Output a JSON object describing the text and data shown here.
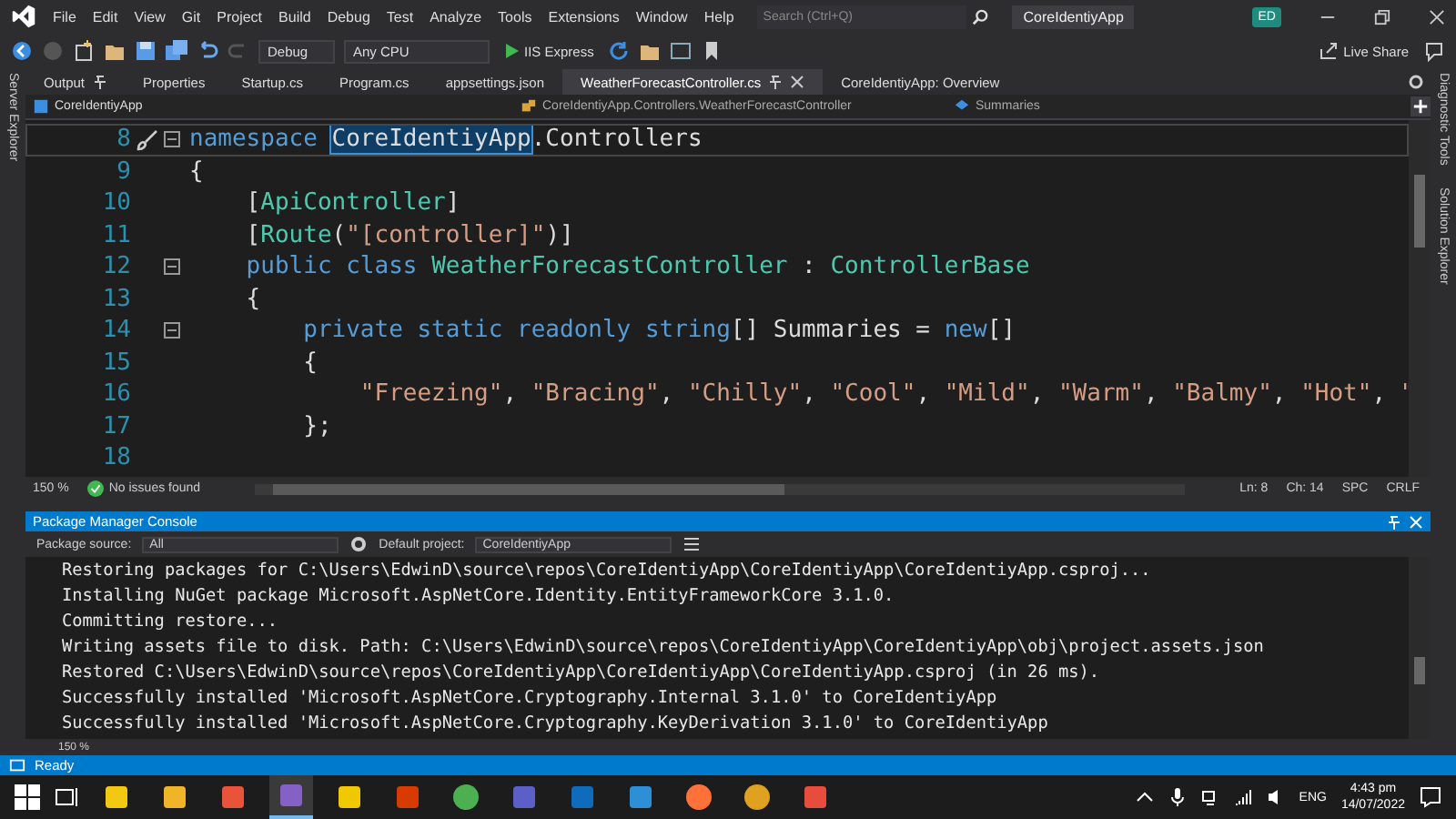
{
  "title_bar": {
    "menu": [
      "File",
      "Edit",
      "View",
      "Git",
      "Project",
      "Build",
      "Debug",
      "Test",
      "Analyze",
      "Tools",
      "Extensions",
      "Window",
      "Help"
    ],
    "search": {
      "placeholder": "Search (Ctrl+Q)"
    },
    "solution_name": "CoreIdentiyApp",
    "avatar": "ED"
  },
  "toolbar": {
    "configuration": "Debug",
    "platform": "Any CPU",
    "run_target": "IIS Express",
    "live_share": "Live Share"
  },
  "left_strip": [
    "Server Explorer"
  ],
  "right_strip": [
    "Diagnostic Tools",
    "Solution Explorer"
  ],
  "tabs": [
    {
      "label": "Output",
      "selected": false,
      "pinned": true
    },
    {
      "label": "Properties",
      "selected": false,
      "pinned": false
    },
    {
      "label": "Startup.cs",
      "selected": false,
      "pinned": false
    },
    {
      "label": "Program.cs",
      "selected": false,
      "pinned": false
    },
    {
      "label": "appsettings.json",
      "selected": false,
      "pinned": false
    },
    {
      "label": "WeatherForecastController.cs",
      "selected": true,
      "pinned": true
    },
    {
      "label": "CoreIdentiyApp: Overview",
      "selected": false,
      "pinned": false
    }
  ],
  "nav_bar": {
    "project": "CoreIdentiyApp",
    "type": "CoreIdentiyApp.Controllers.WeatherForecastController",
    "member": "Summaries"
  },
  "code": [
    {
      "number": "8",
      "fold": true,
      "current": true,
      "tokens": [
        {
          "text": "namespace ",
          "kind": "keyword"
        },
        {
          "text": "CoreIdentiyApp",
          "kind": "highlight"
        },
        {
          "text": ".Controllers",
          "kind": "plain"
        }
      ]
    },
    {
      "number": "9",
      "fold": false,
      "current": false,
      "tokens": [
        {
          "text": "{",
          "kind": "plain"
        }
      ]
    },
    {
      "number": "10",
      "fold": false,
      "current": false,
      "tokens": [
        {
          "text": "    [",
          "kind": "plain"
        },
        {
          "text": "ApiController",
          "kind": "type"
        },
        {
          "text": "]",
          "kind": "plain"
        }
      ]
    },
    {
      "number": "11",
      "fold": false,
      "current": false,
      "tokens": [
        {
          "text": "    [",
          "kind": "plain"
        },
        {
          "text": "Route",
          "kind": "type"
        },
        {
          "text": "(",
          "kind": "plain"
        },
        {
          "text": "\"[controller]\"",
          "kind": "string"
        },
        {
          "text": ")]",
          "kind": "plain"
        }
      ]
    },
    {
      "number": "12",
      "fold": true,
      "current": false,
      "tokens": [
        {
          "text": "    public class ",
          "kind": "keyword"
        },
        {
          "text": "WeatherForecastController",
          "kind": "type"
        },
        {
          "text": " : ",
          "kind": "plain"
        },
        {
          "text": "ControllerBase",
          "kind": "type"
        }
      ]
    },
    {
      "number": "13",
      "fold": false,
      "current": false,
      "tokens": [
        {
          "text": "    {",
          "kind": "plain"
        }
      ]
    },
    {
      "number": "14",
      "fold": true,
      "current": false,
      "tokens": [
        {
          "text": "        private static readonly string",
          "kind": "keyword"
        },
        {
          "text": "[] Summaries = ",
          "kind": "plain"
        },
        {
          "text": "new",
          "kind": "keyword"
        },
        {
          "text": "[]",
          "kind": "plain"
        }
      ]
    },
    {
      "number": "15",
      "fold": false,
      "current": false,
      "tokens": [
        {
          "text": "        {",
          "kind": "plain"
        }
      ]
    },
    {
      "number": "16",
      "fold": false,
      "current": false,
      "tokens": [
        {
          "text": "            \"Freezing\"",
          "kind": "string"
        },
        {
          "text": ", ",
          "kind": "plain"
        },
        {
          "text": "\"Bracing\"",
          "kind": "string"
        },
        {
          "text": ", ",
          "kind": "plain"
        },
        {
          "text": "\"Chilly\"",
          "kind": "string"
        },
        {
          "text": ", ",
          "kind": "plain"
        },
        {
          "text": "\"Cool\"",
          "kind": "string"
        },
        {
          "text": ", ",
          "kind": "plain"
        },
        {
          "text": "\"Mild\"",
          "kind": "string"
        },
        {
          "text": ", ",
          "kind": "plain"
        },
        {
          "text": "\"Warm\"",
          "kind": "string"
        },
        {
          "text": ", ",
          "kind": "plain"
        },
        {
          "text": "\"Balmy\"",
          "kind": "string"
        },
        {
          "text": ", ",
          "kind": "plain"
        },
        {
          "text": "\"Hot\"",
          "kind": "string"
        },
        {
          "text": ", ",
          "kind": "plain"
        },
        {
          "text": "\"",
          "kind": "string"
        }
      ]
    },
    {
      "number": "17",
      "fold": false,
      "current": false,
      "tokens": [
        {
          "text": "        };",
          "kind": "plain"
        }
      ]
    },
    {
      "number": "18",
      "fold": false,
      "current": false
    }
  ],
  "editor_status": {
    "zoom": "150 %",
    "issues": "No issues found",
    "line": "Ln: 8",
    "column": "Ch: 14",
    "whitespace": "SPC",
    "line_ending": "CRLF"
  },
  "console": {
    "title": "Package Manager Console",
    "source_label": "Package source:",
    "source": "All",
    "project_label": "Default project:",
    "project": "CoreIdentiyApp",
    "zoom": "150 %",
    "lines": [
      "Restoring packages for C:\\Users\\EdwinD\\source\\repos\\CoreIdentiyApp\\CoreIdentiyApp\\CoreIdentiyApp.csproj...",
      "Installing NuGet package Microsoft.AspNetCore.Identity.EntityFrameworkCore 3.1.0.",
      "Committing restore...",
      "Writing assets file to disk. Path: C:\\Users\\EdwinD\\source\\repos\\CoreIdentiyApp\\CoreIdentiyApp\\obj\\project.assets.json",
      "Restored C:\\Users\\EdwinD\\source\\repos\\CoreIdentiyApp\\CoreIdentiyApp\\CoreIdentiyApp.csproj (in 26 ms).",
      "Successfully installed 'Microsoft.AspNetCore.Cryptography.Internal 3.1.0' to CoreIdentiyApp",
      "Successfully installed 'Microsoft.AspNetCore.Cryptography.KeyDerivation 3.1.0' to CoreIdentiyApp"
    ]
  },
  "status_bar": {
    "text": "Ready"
  },
  "taskbar": {
    "apps": [
      {
        "selected": false
      },
      {
        "selected": false
      },
      {
        "selected": false
      },
      {
        "selected": true
      },
      {
        "selected": false
      },
      {
        "selected": false
      },
      {
        "selected": false
      },
      {
        "selected": false
      },
      {
        "selected": false
      },
      {
        "selected": false
      },
      {
        "selected": false
      },
      {
        "selected": false
      },
      {
        "selected": false
      }
    ],
    "language": "ENG",
    "time": "4:43 pm",
    "date": "14/07/2022"
  }
}
